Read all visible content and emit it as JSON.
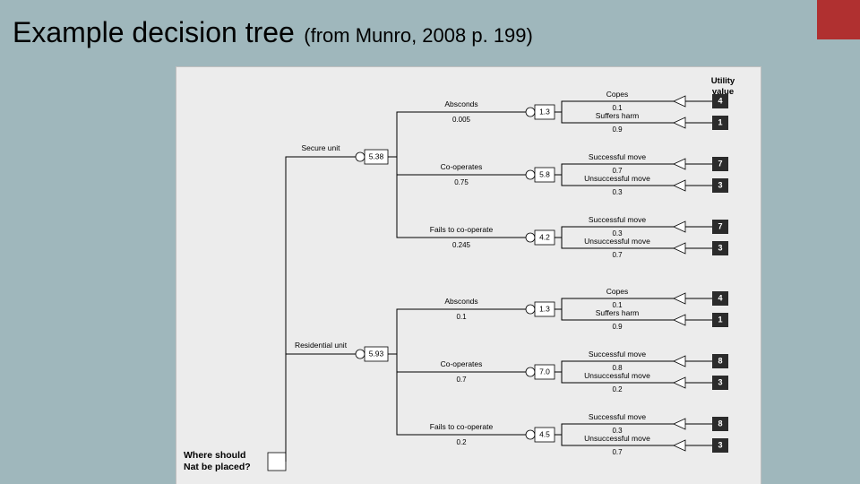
{
  "title": {
    "main": "Example decision tree",
    "sub": "(from Munro, 2008 p. 199)"
  },
  "header": {
    "utility": "Utility",
    "value": "value"
  },
  "root": {
    "label_l1": "Where should",
    "label_l2": "Nat be placed?"
  },
  "level1": {
    "secure": {
      "label": "Secure unit",
      "ev": "5.38"
    },
    "residential": {
      "label": "Residential unit",
      "ev": "5.93"
    }
  },
  "level2": {
    "sec_absc": {
      "label": "Absconds",
      "prob": "0.005",
      "ev": "1.3"
    },
    "sec_coop": {
      "label": "Co-operates",
      "prob": "0.75",
      "ev": "5.8"
    },
    "sec_fail": {
      "label": "Fails to co-operate",
      "prob": "0.245",
      "ev": "4.2"
    },
    "res_absc": {
      "label": "Absconds",
      "prob": "0.1",
      "ev": "1.3"
    },
    "res_coop": {
      "label": "Co-operates",
      "prob": "0.7",
      "ev": "7.0"
    },
    "res_fail": {
      "label": "Fails to co-operate",
      "prob": "0.2",
      "ev": "4.5"
    }
  },
  "terminals": {
    "t1": {
      "label": "Copes",
      "prob": "0.1",
      "util": "4"
    },
    "t2": {
      "label": "Suffers harm",
      "prob": "0.9",
      "util": "1"
    },
    "t3": {
      "label": "Successful move",
      "prob": "0.7",
      "util": "7"
    },
    "t4": {
      "label": "Unsuccessful move",
      "prob": "0.3",
      "util": "3"
    },
    "t5": {
      "label": "Successful move",
      "prob": "0.3",
      "util": "7"
    },
    "t6": {
      "label": "Unsuccessful move",
      "prob": "0.7",
      "util": "3"
    },
    "t7": {
      "label": "Copes",
      "prob": "0.1",
      "util": "4"
    },
    "t8": {
      "label": "Suffers harm",
      "prob": "0.9",
      "util": "1"
    },
    "t9": {
      "label": "Successful move",
      "prob": "0.8",
      "util": "8"
    },
    "t10": {
      "label": "Unsuccessful move",
      "prob": "0.2",
      "util": "3"
    },
    "t11": {
      "label": "Successful move",
      "prob": "0.3",
      "util": "8"
    },
    "t12": {
      "label": "Unsuccessful move",
      "prob": "0.7",
      "util": "3"
    }
  }
}
